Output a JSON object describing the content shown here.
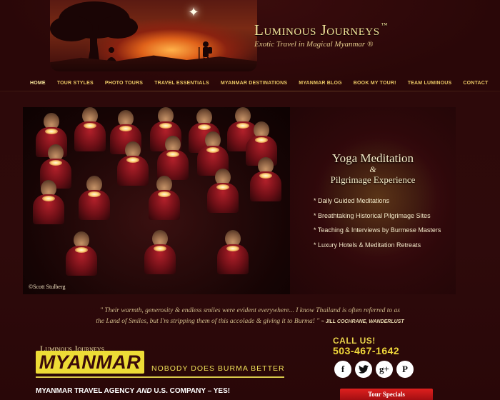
{
  "brand": {
    "title": "Luminous Journeys",
    "tm": "™",
    "tagline": "Exotic Travel in Magical Myanmar ®"
  },
  "nav": {
    "items": [
      {
        "label": "HOME",
        "active": true
      },
      {
        "label": "TOUR STYLES"
      },
      {
        "label": "PHOTO TOURS"
      },
      {
        "label": "TRAVEL ESSENTIALS"
      },
      {
        "label": "MYANMAR DESTINATIONS"
      },
      {
        "label": "MYANMAR BLOG"
      },
      {
        "label": "BOOK MY TOUR!"
      },
      {
        "label": "TEAM LUMINOUS"
      },
      {
        "label": "CONTACT"
      }
    ]
  },
  "hero": {
    "photo_credit": "©Scott Stulberg",
    "promo_title": "Yoga Meditation",
    "promo_amp": "&",
    "promo_subtitle": "Pilgrimage Experience",
    "promo_items": [
      "* Daily Guided Meditations",
      "* Breathtaking Historical Pilgrimage Sites",
      "* Teaching & Interviews by Burmese Masters",
      "* Luxury Hotels & Meditation Retreats"
    ]
  },
  "testimonial": {
    "line1": "\" Their warmth, generosity & endless smiles were evident everywhere... I know Thailand is often referred to as",
    "line2": "the Land of Smiles, but I'm stripping them of this accolade & giving it to Burma! \"",
    "attribution": "~ JILL COCHRANE, WANDERLUST"
  },
  "footer_brand": {
    "small": "Luminous Journeys",
    "big": "MYANMAR",
    "slogan": "NOBODY DOES BURMA BETTER",
    "company_a": "MYANMAR TRAVEL AGENCY ",
    "company_and": "AND",
    "company_b": " U.S. COMPANY – YES!"
  },
  "contact": {
    "call_label": "CALL  US!",
    "phone": "503-467-1642",
    "social": {
      "facebook": "f",
      "twitter": "t",
      "googleplus": "g+",
      "pinterest": "P"
    },
    "tour_specials": "Tour Specials"
  },
  "colors": {
    "background": "#2a0708",
    "nav_text": "#e8c564",
    "accent_yellow": "#eddc36",
    "tab_red": "#c0181a"
  },
  "icons": [
    "star-icon",
    "facebook-icon",
    "twitter-icon",
    "google-plus-icon",
    "pinterest-icon"
  ]
}
